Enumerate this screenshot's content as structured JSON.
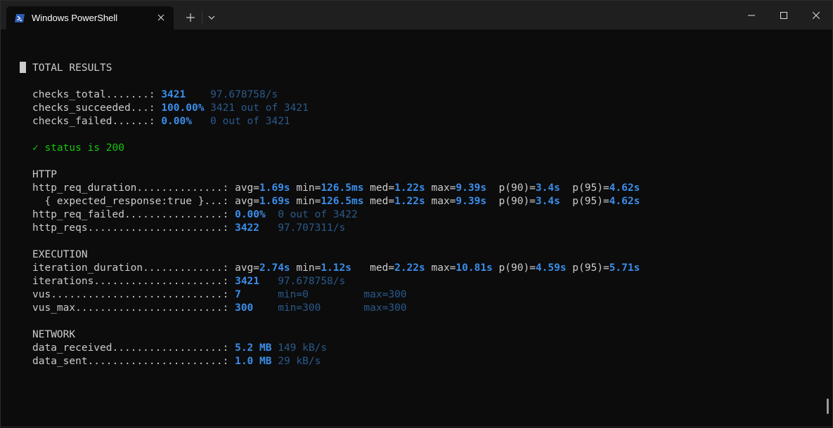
{
  "window": {
    "tab_title": "Windows PowerShell",
    "icons": {
      "app": "powershell-icon",
      "tab_close": "close-icon",
      "new_tab": "plus-icon",
      "dropdown": "chevron-down-icon",
      "minimize": "minimize-icon",
      "maximize": "maximize-icon",
      "close": "close-icon"
    },
    "colors": {
      "background": "#0c0c0c",
      "titlebar": "#1f1f1f",
      "text": "#cccccc",
      "accent_value": "#3b8eea",
      "dim_value": "#2a5a8c",
      "success": "#16c60c"
    }
  },
  "terminal": {
    "heading": "TOTAL RESULTS",
    "checks_total": {
      "label": "checks_total.......: ",
      "value": "3421",
      "extra": "    97.678758/s"
    },
    "checks_succeeded": {
      "label": "checks_succeeded...: ",
      "value": "100.00%",
      "extra": " 3421 out of 3421"
    },
    "checks_failed": {
      "label": "checks_failed......: ",
      "value": "0.00%",
      "extra": "   0 out of 3421"
    },
    "status_check": "✓ status is 200",
    "http": {
      "heading": "HTTP",
      "req_duration": {
        "label": "http_req_duration..............: ",
        "avg_k": "avg=",
        "avg": "1.69s",
        "min_k": " min=",
        "min": "126.5ms",
        "med_k": " med=",
        "med": "1.22s",
        "max_k": " max=",
        "max": "9.39s",
        "p90_k": "  p(90)=",
        "p90": "3.4s",
        "p95_k": "  p(95)=",
        "p95": "4.62s"
      },
      "expected_response": {
        "label": "  { expected_response:true }...: ",
        "avg_k": "avg=",
        "avg": "1.69s",
        "min_k": " min=",
        "min": "126.5ms",
        "med_k": " med=",
        "med": "1.22s",
        "max_k": " max=",
        "max": "9.39s",
        "p90_k": "  p(90)=",
        "p90": "3.4s",
        "p95_k": "  p(95)=",
        "p95": "4.62s"
      },
      "req_failed": {
        "label": "http_req_failed................: ",
        "value": "0.00%",
        "extra": "  0 out of 3422"
      },
      "reqs": {
        "label": "http_reqs......................: ",
        "value": "3422",
        "extra": "   97.707311/s"
      }
    },
    "execution": {
      "heading": "EXECUTION",
      "iteration_duration": {
        "label": "iteration_duration.............: ",
        "avg_k": "avg=",
        "avg": "2.74s",
        "min_k": " min=",
        "min": "1.12s",
        "med_k": "   med=",
        "med": "2.22s",
        "max_k": " max=",
        "max": "10.81s",
        "p90_k": " p(90)=",
        "p90": "4.59s",
        "p95_k": " p(95)=",
        "p95": "5.71s"
      },
      "iterations": {
        "label": "iterations.....................: ",
        "value": "3421",
        "extra": "   97.678758/s"
      },
      "vus": {
        "label": "vus............................: ",
        "value": "7",
        "extra": "      min=0         max=300"
      },
      "vus_max": {
        "label": "vus_max........................: ",
        "value": "300",
        "extra": "    min=300       max=300"
      }
    },
    "network": {
      "heading": "NETWORK",
      "data_received": {
        "label": "data_received..................: ",
        "value": "5.2 MB",
        "extra": " 149 kB/s"
      },
      "data_sent": {
        "label": "data_sent......................: ",
        "value": "1.0 MB",
        "extra": " 29 kB/s"
      }
    }
  }
}
